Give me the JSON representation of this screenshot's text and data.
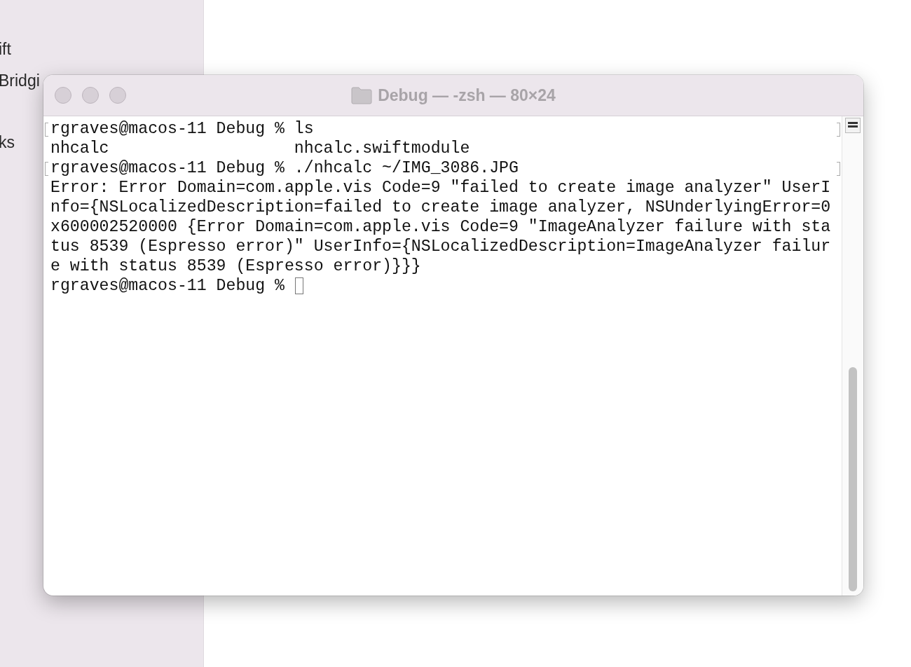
{
  "sidebar": {
    "items": [
      "ift",
      "Bridgi",
      "ks"
    ]
  },
  "terminal": {
    "title": "Debug — -zsh — 80×24",
    "lines": [
      {
        "text": "rgraves@macos-11 Debug % ls",
        "marked": true,
        "cursor": false
      },
      {
        "text": "nhcalc                   nhcalc.swiftmodule",
        "marked": false,
        "cursor": false
      },
      {
        "text": "rgraves@macos-11 Debug % ./nhcalc ~/IMG_3086.JPG",
        "marked": true,
        "cursor": false
      },
      {
        "text": "Error: Error Domain=com.apple.vis Code=9 \"failed to create image analyzer\" UserI",
        "marked": false,
        "cursor": false
      },
      {
        "text": "nfo={NSLocalizedDescription=failed to create image analyzer, NSUnderlyingError=0",
        "marked": false,
        "cursor": false
      },
      {
        "text": "x600002520000 {Error Domain=com.apple.vis Code=9 \"ImageAnalyzer failure with sta",
        "marked": false,
        "cursor": false
      },
      {
        "text": "tus 8539 (Espresso error)\" UserInfo={NSLocalizedDescription=ImageAnalyzer failur",
        "marked": false,
        "cursor": false
      },
      {
        "text": "e with status 8539 (Espresso error)}}}",
        "marked": false,
        "cursor": false
      },
      {
        "text": "rgraves@macos-11 Debug % ",
        "marked": false,
        "cursor": true
      }
    ]
  }
}
